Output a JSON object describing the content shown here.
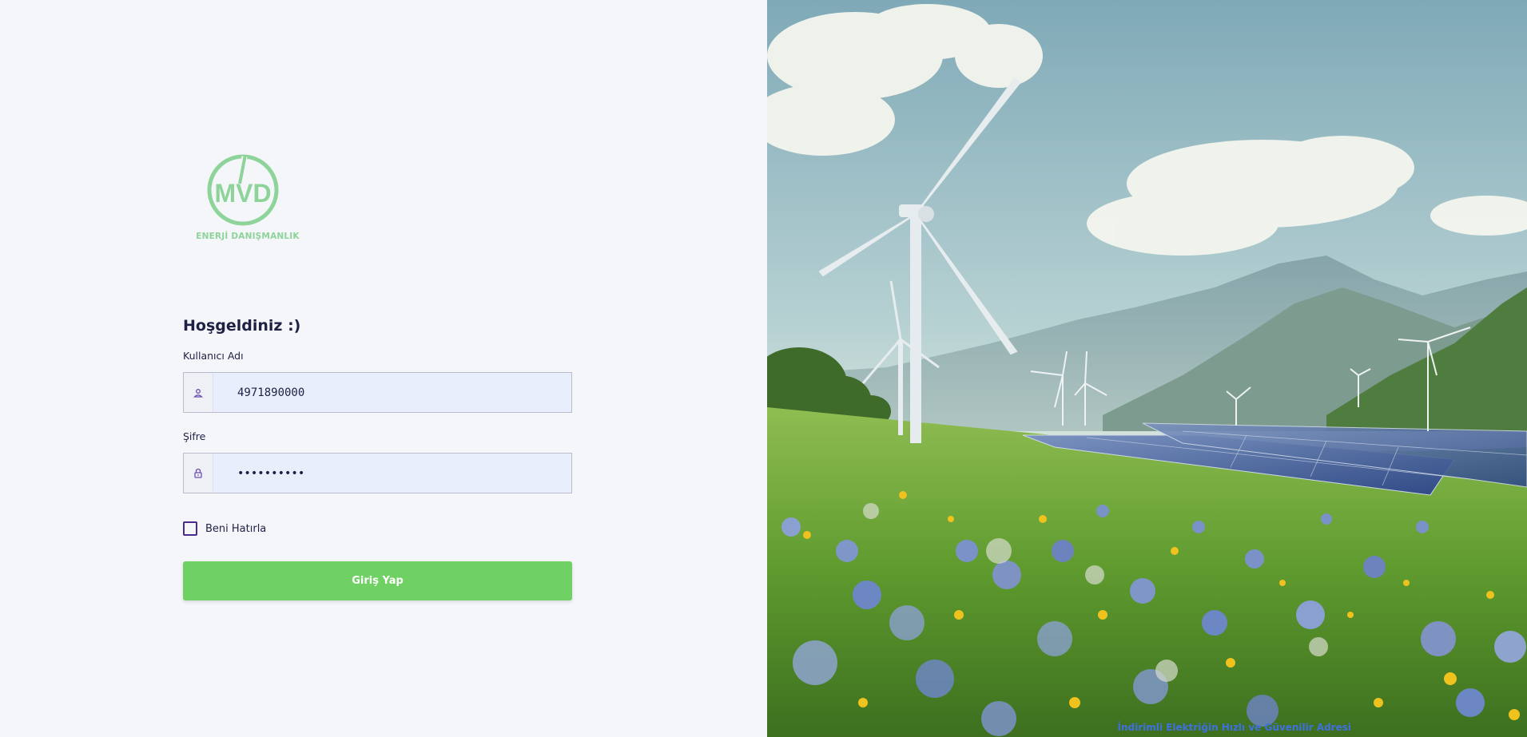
{
  "brand": {
    "logo_text": "MVD",
    "logo_subtitle": "ENERJİ DANIŞMANLIK",
    "accent_color": "#8ed49a"
  },
  "login": {
    "welcome_title": "Hoşgeldiniz :)",
    "username_label": "Kullanıcı Adı",
    "username_value": "4971890000",
    "username_icon": "user-icon",
    "password_label": "Şifre",
    "password_value": "••••••••••",
    "password_icon": "lock-icon",
    "remember_label": "Beni Hatırla",
    "remember_checked": false,
    "submit_label": "Giriş Yap",
    "submit_color": "#6fd163"
  },
  "hero": {
    "tagline": "İndirimli Elektriğin Hızlı ve Güvenilir Adresi",
    "tagline_color": "#3f6fe0",
    "image_description_icon": "wind-solar-landscape-image"
  }
}
